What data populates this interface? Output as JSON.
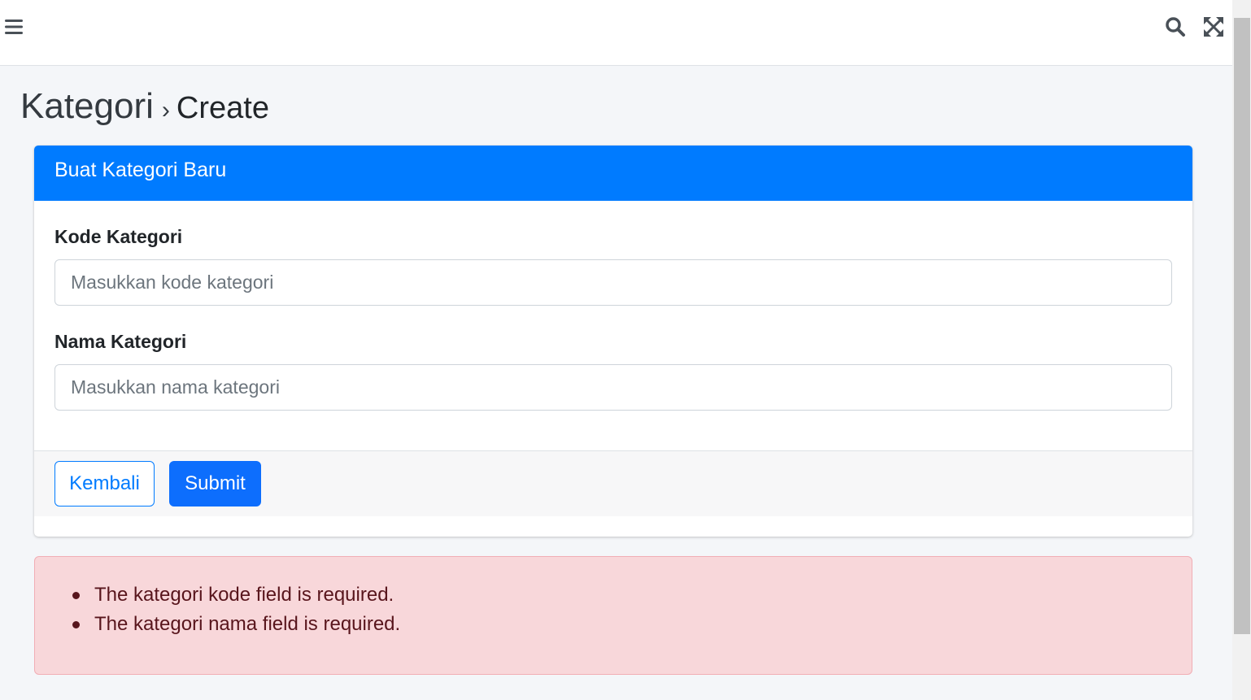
{
  "navbar": {
    "menu_icon": "hamburger-icon",
    "search_icon": "search-icon",
    "fullscreen_icon": "expand-arrows-icon"
  },
  "page": {
    "title": "Kategori",
    "separator": "›",
    "subtitle": "Create"
  },
  "card": {
    "header": "Buat Kategori Baru",
    "fields": [
      {
        "label": "Kode Kategori",
        "placeholder": "Masukkan kode kategori",
        "value": ""
      },
      {
        "label": "Nama Kategori",
        "placeholder": "Masukkan nama kategori",
        "value": ""
      }
    ],
    "back_label": "Kembali",
    "submit_label": "Submit"
  },
  "errors": [
    "The kategori kode field is required.",
    "The kategori nama field is required."
  ],
  "colors": {
    "primary": "#007bff",
    "submit": "#0d6efd",
    "alert_bg": "#f8d7da",
    "alert_text": "#58151c"
  }
}
